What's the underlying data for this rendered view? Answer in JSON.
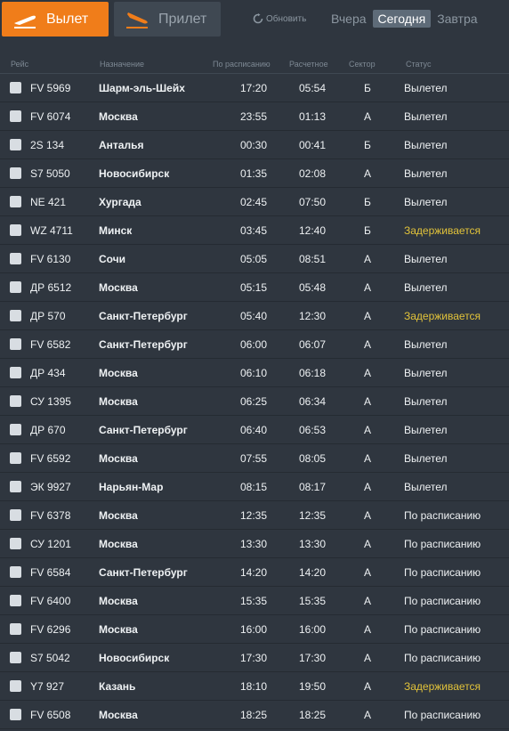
{
  "tabs": {
    "departure": "Вылет",
    "arrival": "Прилет"
  },
  "refresh_label": "Обновить",
  "days": [
    "Вчера",
    "Сегодня",
    "Завтра"
  ],
  "active_day": "Сегодня",
  "columns": {
    "flight": "Рейс",
    "destination": "Назначение",
    "scheduled": "По расписанию",
    "estimated": "Расчетное",
    "sector": "Сектор",
    "status": "Статус"
  },
  "colors": {
    "departure_tab": "#f07d1a",
    "delayed_status": "#e2c33a",
    "background": "#2f363f"
  },
  "flights": [
    {
      "flight": "FV 5969",
      "destination": "Шарм-эль-Шейх",
      "scheduled": "17:20",
      "estimated": "05:54",
      "sector": "Б",
      "status": "Вылетел",
      "delayed": false
    },
    {
      "flight": "FV 6074",
      "destination": "Москва",
      "scheduled": "23:55",
      "estimated": "01:13",
      "sector": "А",
      "status": "Вылетел",
      "delayed": false
    },
    {
      "flight": "2S 134",
      "destination": "Анталья",
      "scheduled": "00:30",
      "estimated": "00:41",
      "sector": "Б",
      "status": "Вылетел",
      "delayed": false
    },
    {
      "flight": "S7 5050",
      "destination": "Новосибирск",
      "scheduled": "01:35",
      "estimated": "02:08",
      "sector": "А",
      "status": "Вылетел",
      "delayed": false
    },
    {
      "flight": "NE 421",
      "destination": "Хургада",
      "scheduled": "02:45",
      "estimated": "07:50",
      "sector": "Б",
      "status": "Вылетел",
      "delayed": false
    },
    {
      "flight": "WZ 4711",
      "destination": "Минск",
      "scheduled": "03:45",
      "estimated": "12:40",
      "sector": "Б",
      "status": "Задерживается",
      "delayed": true
    },
    {
      "flight": "FV 6130",
      "destination": "Сочи",
      "scheduled": "05:05",
      "estimated": "08:51",
      "sector": "А",
      "status": "Вылетел",
      "delayed": false
    },
    {
      "flight": "ДР 6512",
      "destination": "Москва",
      "scheduled": "05:15",
      "estimated": "05:48",
      "sector": "А",
      "status": "Вылетел",
      "delayed": false
    },
    {
      "flight": "ДР 570",
      "destination": "Санкт-Петербург",
      "scheduled": "05:40",
      "estimated": "12:30",
      "sector": "А",
      "status": "Задерживается",
      "delayed": true
    },
    {
      "flight": "FV 6582",
      "destination": "Санкт-Петербург",
      "scheduled": "06:00",
      "estimated": "06:07",
      "sector": "А",
      "status": "Вылетел",
      "delayed": false
    },
    {
      "flight": "ДР 434",
      "destination": "Москва",
      "scheduled": "06:10",
      "estimated": "06:18",
      "sector": "А",
      "status": "Вылетел",
      "delayed": false
    },
    {
      "flight": "СУ 1395",
      "destination": "Москва",
      "scheduled": "06:25",
      "estimated": "06:34",
      "sector": "А",
      "status": "Вылетел",
      "delayed": false
    },
    {
      "flight": "ДР 670",
      "destination": "Санкт-Петербург",
      "scheduled": "06:40",
      "estimated": "06:53",
      "sector": "А",
      "status": "Вылетел",
      "delayed": false
    },
    {
      "flight": "FV 6592",
      "destination": "Москва",
      "scheduled": "07:55",
      "estimated": "08:05",
      "sector": "А",
      "status": "Вылетел",
      "delayed": false
    },
    {
      "flight": "ЭК 9927",
      "destination": "Нарьян-Мар",
      "scheduled": "08:15",
      "estimated": "08:17",
      "sector": "А",
      "status": "Вылетел",
      "delayed": false
    },
    {
      "flight": "FV 6378",
      "destination": "Москва",
      "scheduled": "12:35",
      "estimated": "12:35",
      "sector": "А",
      "status": "По расписанию",
      "delayed": false
    },
    {
      "flight": "СУ 1201",
      "destination": "Москва",
      "scheduled": "13:30",
      "estimated": "13:30",
      "sector": "А",
      "status": "По расписанию",
      "delayed": false
    },
    {
      "flight": "FV 6584",
      "destination": "Санкт-Петербург",
      "scheduled": "14:20",
      "estimated": "14:20",
      "sector": "А",
      "status": "По расписанию",
      "delayed": false
    },
    {
      "flight": "FV 6400",
      "destination": "Москва",
      "scheduled": "15:35",
      "estimated": "15:35",
      "sector": "А",
      "status": "По расписанию",
      "delayed": false
    },
    {
      "flight": "FV 6296",
      "destination": "Москва",
      "scheduled": "16:00",
      "estimated": "16:00",
      "sector": "А",
      "status": "По расписанию",
      "delayed": false
    },
    {
      "flight": "S7 5042",
      "destination": "Новосибирск",
      "scheduled": "17:30",
      "estimated": "17:30",
      "sector": "А",
      "status": "По расписанию",
      "delayed": false
    },
    {
      "flight": "Y7 927",
      "destination": "Казань",
      "scheduled": "18:10",
      "estimated": "19:50",
      "sector": "А",
      "status": "Задерживается",
      "delayed": true
    },
    {
      "flight": "FV 6508",
      "destination": "Москва",
      "scheduled": "18:25",
      "estimated": "18:25",
      "sector": "А",
      "status": "По расписанию",
      "delayed": false
    }
  ]
}
